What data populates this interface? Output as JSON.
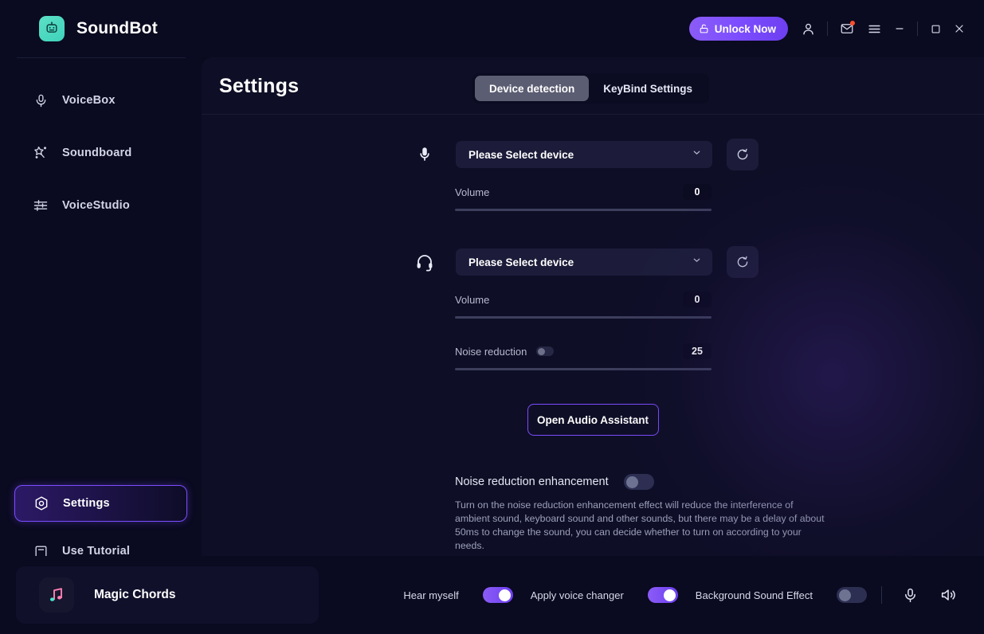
{
  "app": {
    "brand_name": "SoundBot",
    "logo_icon": "robot-icon"
  },
  "titlebar": {
    "unlock_label": "Unlock Now",
    "unlock_icon": "lock-icon",
    "account_icon": "user-icon",
    "mail_icon": "mail-icon",
    "menu_icon": "hamburger-icon",
    "minimize_icon": "minimize-icon",
    "maximize_icon": "maximize-icon",
    "close_icon": "close-icon",
    "accent_color": "#7c4dff"
  },
  "sidebar": {
    "items": [
      {
        "label": "VoiceBox",
        "icon": "microphone-icon",
        "active": false
      },
      {
        "label": "Soundboard",
        "icon": "magic-wand-icon",
        "active": false
      },
      {
        "label": "VoiceStudio",
        "icon": "sliders-icon",
        "active": false
      }
    ],
    "bottom_items": [
      {
        "label": "Settings",
        "icon": "settings-target-icon",
        "active": true
      },
      {
        "label": "Use Tutorial",
        "icon": "book-icon",
        "active": false
      }
    ],
    "mini_icons": [
      {
        "name": "gift-box-icon",
        "badge": true
      },
      {
        "name": "chat-smiley-icon",
        "badge": false
      }
    ]
  },
  "main": {
    "title": "Settings",
    "tabs": [
      {
        "label": "Device detection",
        "active": true
      },
      {
        "label": "KeyBind Settings",
        "active": false
      }
    ],
    "microphone_section": {
      "icon": "microphone-icon",
      "device_value": "Please Select device",
      "device_placeholder": "Please Select device",
      "refresh_icon": "refresh-icon",
      "volume_label": "Volume",
      "volume_value": "0"
    },
    "headset_section": {
      "icon": "headset-icon",
      "device_value": "Please Select device",
      "device_placeholder": "Please Select device",
      "refresh_icon": "refresh-icon",
      "volume_label": "Volume",
      "volume_value": "0",
      "noise_label": "Noise reduction",
      "noise_value": "25",
      "noise_toggle_on": false
    },
    "audio_assistant_label": "Open Audio Assistant",
    "enhancement": {
      "label": "Noise reduction enhancement",
      "toggle_on": false,
      "description": "Turn on the noise reduction enhancement effect will reduce the interference of ambient sound, keyboard sound and other sounds, but there may be a delay of about 50ms to change the sound, you can decide whether to turn on according to your needs."
    }
  },
  "bottombar": {
    "track_name": "Magic Chords",
    "track_icon": "music-note-icon",
    "hear_myself_label": "Hear myself",
    "hear_myself_on": true,
    "voice_changer_label": "Apply voice changer",
    "voice_changer_on": true,
    "background_sfx_label": "Background Sound Effect",
    "background_sfx_on": false,
    "mic_icon": "microphone-icon",
    "speaker_icon": "speaker-icon"
  }
}
